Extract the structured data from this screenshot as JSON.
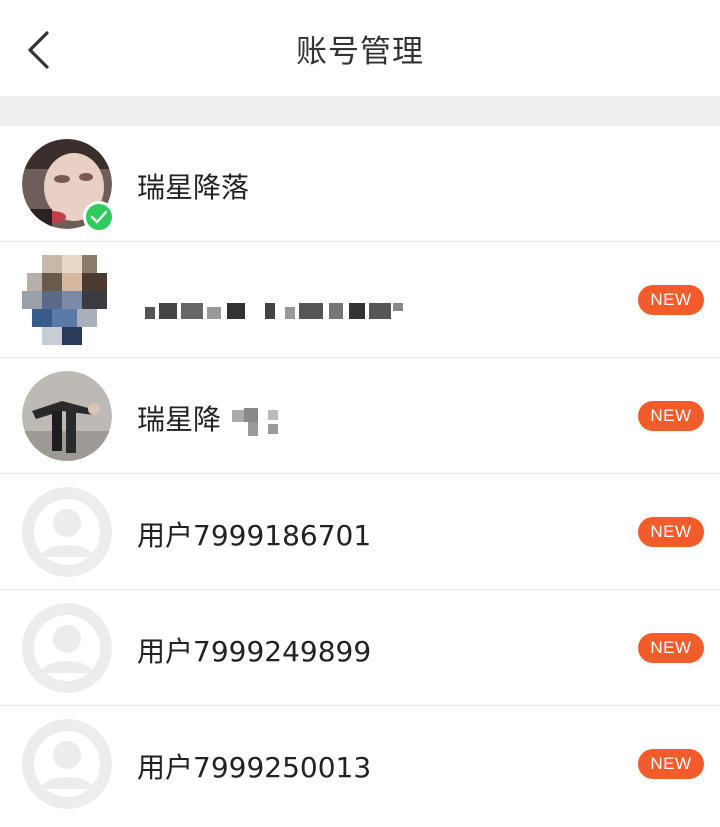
{
  "header": {
    "title": "账号管理",
    "back_icon": "chevron-left-icon"
  },
  "accounts": [
    {
      "name": "瑞星降落",
      "current": true,
      "badge": ""
    },
    {
      "name": "",
      "current": false,
      "badge": "NEW"
    },
    {
      "name": "瑞星降",
      "current": false,
      "badge": "NEW"
    },
    {
      "name": "用户7999186701",
      "current": false,
      "badge": "NEW"
    },
    {
      "name": "用户7999249899",
      "current": false,
      "badge": "NEW"
    },
    {
      "name": "用户7999250013",
      "current": false,
      "badge": "NEW"
    }
  ],
  "colors": {
    "badge": "#f25c2b",
    "check": "#2ecc5b",
    "separator": "#efefef"
  }
}
